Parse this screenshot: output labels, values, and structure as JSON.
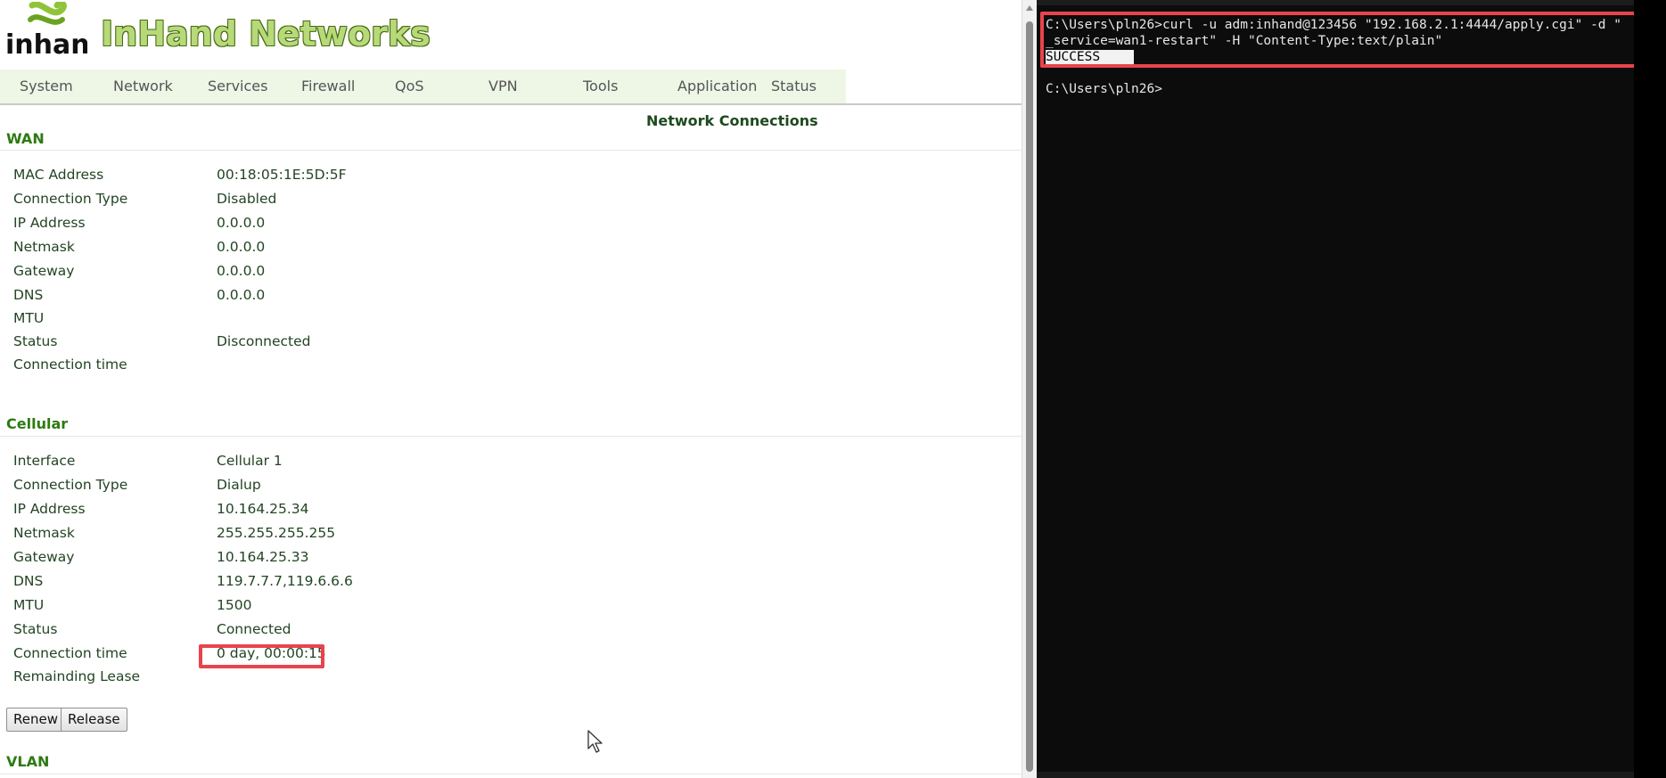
{
  "brand": {
    "name": "InHand Networks"
  },
  "nav": [
    "System",
    "Network",
    "Services",
    "Firewall",
    "QoS",
    "VPN",
    "Tools",
    "Application",
    "Status"
  ],
  "page_title": "Network Connections",
  "wan": {
    "heading": "WAN",
    "rows": [
      {
        "label": "MAC Address",
        "value": "00:18:05:1E:5D:5F"
      },
      {
        "label": "Connection Type",
        "value": "Disabled"
      },
      {
        "label": "IP Address",
        "value": "0.0.0.0"
      },
      {
        "label": "Netmask",
        "value": "0.0.0.0"
      },
      {
        "label": "Gateway",
        "value": "0.0.0.0"
      },
      {
        "label": "DNS",
        "value": "0.0.0.0"
      },
      {
        "label": "MTU",
        "value": ""
      },
      {
        "label": "Status",
        "value": "Disconnected"
      },
      {
        "label": "Connection time",
        "value": ""
      }
    ]
  },
  "cellular": {
    "heading": "Cellular",
    "rows": [
      {
        "label": "Interface",
        "value": "Cellular 1"
      },
      {
        "label": "Connection Type",
        "value": "Dialup"
      },
      {
        "label": "IP Address",
        "value": "10.164.25.34"
      },
      {
        "label": "Netmask",
        "value": "255.255.255.255"
      },
      {
        "label": "Gateway",
        "value": "10.164.25.33"
      },
      {
        "label": "DNS",
        "value": "119.7.7.7,119.6.6.6"
      },
      {
        "label": "MTU",
        "value": "1500"
      },
      {
        "label": "Status",
        "value": "Connected"
      },
      {
        "label": "Connection time",
        "value": "0 day, 00:00:15"
      },
      {
        "label": "Remainding Lease",
        "value": ""
      }
    ],
    "buttons": {
      "renew": "Renew",
      "release": "Release"
    }
  },
  "vlan": {
    "heading": "VLAN"
  },
  "terminal": {
    "line1": "C:\\Users\\pln26>curl -u adm:inhand@123456 \"192.168.2.1:4444/apply.cgi\" -d \"",
    "line2": "_service=wan1-restart\" -H \"Content-Type:text/plain\"",
    "line3": "SUCCESS",
    "line4": "C:\\Users\\pln26>"
  },
  "colors": {
    "accent_green": "#2d7a12",
    "highlight_red": "#e8444d",
    "nav_bg": "#eef6e6"
  }
}
